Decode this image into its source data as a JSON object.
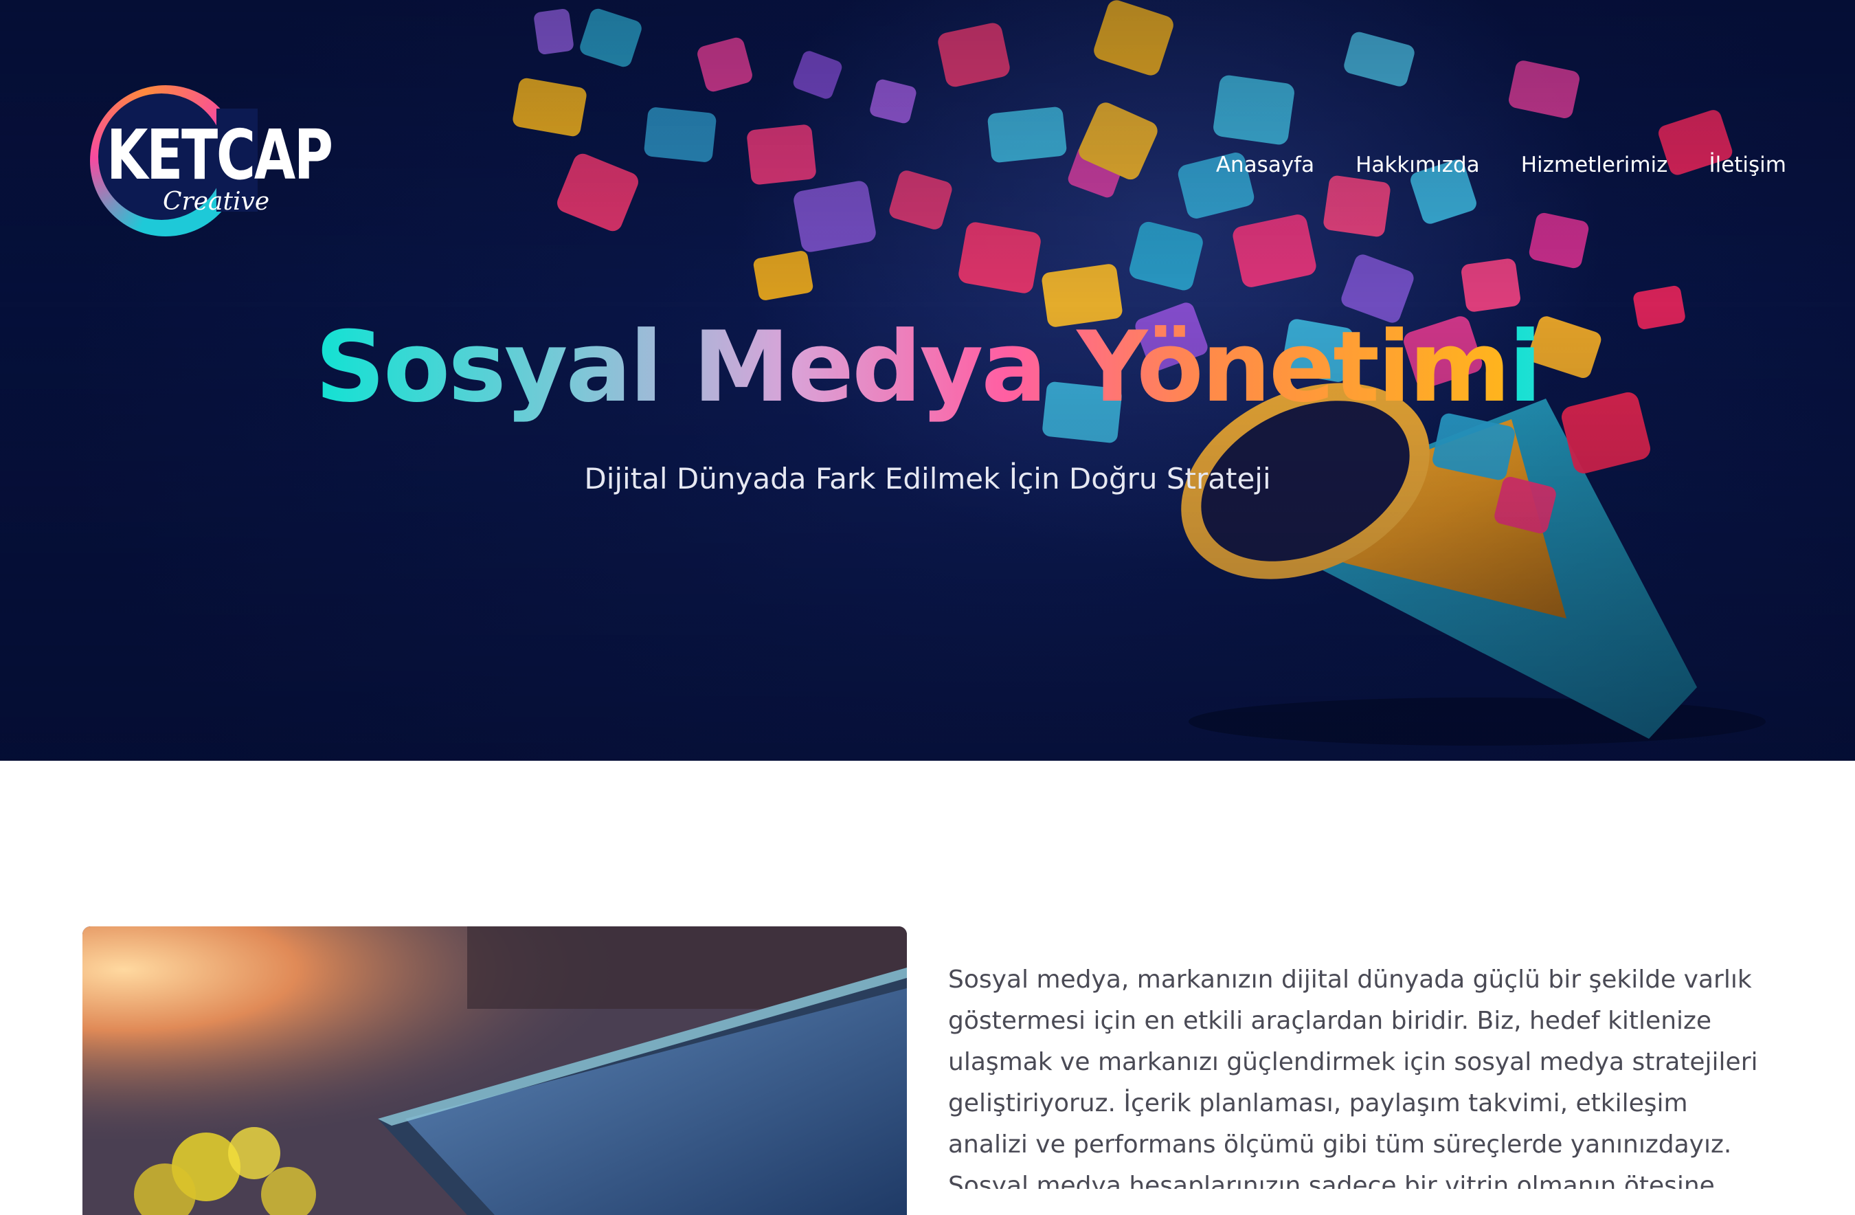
{
  "brand": {
    "logo_main": "KETCAP",
    "logo_sub": "Creative",
    "colors": {
      "cyan": "#12e2d3",
      "pink": "#ff5fa2",
      "orange": "#ffb41d",
      "navy": "#0a1748"
    }
  },
  "nav": {
    "items": [
      "Anasayfa",
      "Hakkımızda",
      "Hizmetlerimiz",
      "İletişim"
    ]
  },
  "hero": {
    "title": "Sosyal Medya Yönetimi",
    "subtitle": "Dijital Dünyada Fark Edilmek İçin Doğru Strateji",
    "background_image": "megaphone-with-social-media-icons"
  },
  "content": {
    "image": "laptop-with-flowers-photo",
    "paragraph": "Sosyal medya, markanızın dijital dünyada güçlü bir şekilde varlık göstermesi için en etkili araçlardan biridir. Biz, hedef kitlenize ulaşmak ve markanızı güçlendirmek için sosyal medya stratejileri geliştiriyoruz. İçerik planlaması, paylaşım takvimi, etkileşim analizi ve performans ölçümü gibi tüm süreçlerde yanınızdayız. Sosyal medya hesaplarınızın sadece bir vitrin olmanın ötesine geçerek"
  }
}
